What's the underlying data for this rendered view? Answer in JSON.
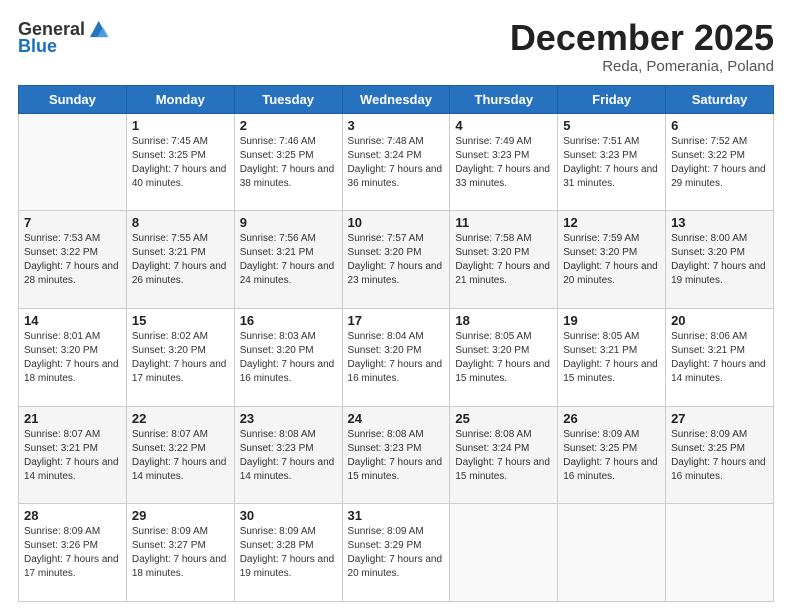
{
  "header": {
    "logo_line1": "General",
    "logo_line2": "Blue",
    "month_title": "December 2025",
    "location": "Reda, Pomerania, Poland"
  },
  "weekdays": [
    "Sunday",
    "Monday",
    "Tuesday",
    "Wednesday",
    "Thursday",
    "Friday",
    "Saturday"
  ],
  "weeks": [
    [
      {
        "day": "",
        "sunrise": "",
        "sunset": "",
        "daylight": ""
      },
      {
        "day": "1",
        "sunrise": "Sunrise: 7:45 AM",
        "sunset": "Sunset: 3:25 PM",
        "daylight": "Daylight: 7 hours and 40 minutes."
      },
      {
        "day": "2",
        "sunrise": "Sunrise: 7:46 AM",
        "sunset": "Sunset: 3:25 PM",
        "daylight": "Daylight: 7 hours and 38 minutes."
      },
      {
        "day": "3",
        "sunrise": "Sunrise: 7:48 AM",
        "sunset": "Sunset: 3:24 PM",
        "daylight": "Daylight: 7 hours and 36 minutes."
      },
      {
        "day": "4",
        "sunrise": "Sunrise: 7:49 AM",
        "sunset": "Sunset: 3:23 PM",
        "daylight": "Daylight: 7 hours and 33 minutes."
      },
      {
        "day": "5",
        "sunrise": "Sunrise: 7:51 AM",
        "sunset": "Sunset: 3:23 PM",
        "daylight": "Daylight: 7 hours and 31 minutes."
      },
      {
        "day": "6",
        "sunrise": "Sunrise: 7:52 AM",
        "sunset": "Sunset: 3:22 PM",
        "daylight": "Daylight: 7 hours and 29 minutes."
      }
    ],
    [
      {
        "day": "7",
        "sunrise": "Sunrise: 7:53 AM",
        "sunset": "Sunset: 3:22 PM",
        "daylight": "Daylight: 7 hours and 28 minutes."
      },
      {
        "day": "8",
        "sunrise": "Sunrise: 7:55 AM",
        "sunset": "Sunset: 3:21 PM",
        "daylight": "Daylight: 7 hours and 26 minutes."
      },
      {
        "day": "9",
        "sunrise": "Sunrise: 7:56 AM",
        "sunset": "Sunset: 3:21 PM",
        "daylight": "Daylight: 7 hours and 24 minutes."
      },
      {
        "day": "10",
        "sunrise": "Sunrise: 7:57 AM",
        "sunset": "Sunset: 3:20 PM",
        "daylight": "Daylight: 7 hours and 23 minutes."
      },
      {
        "day": "11",
        "sunrise": "Sunrise: 7:58 AM",
        "sunset": "Sunset: 3:20 PM",
        "daylight": "Daylight: 7 hours and 21 minutes."
      },
      {
        "day": "12",
        "sunrise": "Sunrise: 7:59 AM",
        "sunset": "Sunset: 3:20 PM",
        "daylight": "Daylight: 7 hours and 20 minutes."
      },
      {
        "day": "13",
        "sunrise": "Sunrise: 8:00 AM",
        "sunset": "Sunset: 3:20 PM",
        "daylight": "Daylight: 7 hours and 19 minutes."
      }
    ],
    [
      {
        "day": "14",
        "sunrise": "Sunrise: 8:01 AM",
        "sunset": "Sunset: 3:20 PM",
        "daylight": "Daylight: 7 hours and 18 minutes."
      },
      {
        "day": "15",
        "sunrise": "Sunrise: 8:02 AM",
        "sunset": "Sunset: 3:20 PM",
        "daylight": "Daylight: 7 hours and 17 minutes."
      },
      {
        "day": "16",
        "sunrise": "Sunrise: 8:03 AM",
        "sunset": "Sunset: 3:20 PM",
        "daylight": "Daylight: 7 hours and 16 minutes."
      },
      {
        "day": "17",
        "sunrise": "Sunrise: 8:04 AM",
        "sunset": "Sunset: 3:20 PM",
        "daylight": "Daylight: 7 hours and 16 minutes."
      },
      {
        "day": "18",
        "sunrise": "Sunrise: 8:05 AM",
        "sunset": "Sunset: 3:20 PM",
        "daylight": "Daylight: 7 hours and 15 minutes."
      },
      {
        "day": "19",
        "sunrise": "Sunrise: 8:05 AM",
        "sunset": "Sunset: 3:21 PM",
        "daylight": "Daylight: 7 hours and 15 minutes."
      },
      {
        "day": "20",
        "sunrise": "Sunrise: 8:06 AM",
        "sunset": "Sunset: 3:21 PM",
        "daylight": "Daylight: 7 hours and 14 minutes."
      }
    ],
    [
      {
        "day": "21",
        "sunrise": "Sunrise: 8:07 AM",
        "sunset": "Sunset: 3:21 PM",
        "daylight": "Daylight: 7 hours and 14 minutes."
      },
      {
        "day": "22",
        "sunrise": "Sunrise: 8:07 AM",
        "sunset": "Sunset: 3:22 PM",
        "daylight": "Daylight: 7 hours and 14 minutes."
      },
      {
        "day": "23",
        "sunrise": "Sunrise: 8:08 AM",
        "sunset": "Sunset: 3:23 PM",
        "daylight": "Daylight: 7 hours and 14 minutes."
      },
      {
        "day": "24",
        "sunrise": "Sunrise: 8:08 AM",
        "sunset": "Sunset: 3:23 PM",
        "daylight": "Daylight: 7 hours and 15 minutes."
      },
      {
        "day": "25",
        "sunrise": "Sunrise: 8:08 AM",
        "sunset": "Sunset: 3:24 PM",
        "daylight": "Daylight: 7 hours and 15 minutes."
      },
      {
        "day": "26",
        "sunrise": "Sunrise: 8:09 AM",
        "sunset": "Sunset: 3:25 PM",
        "daylight": "Daylight: 7 hours and 16 minutes."
      },
      {
        "day": "27",
        "sunrise": "Sunrise: 8:09 AM",
        "sunset": "Sunset: 3:25 PM",
        "daylight": "Daylight: 7 hours and 16 minutes."
      }
    ],
    [
      {
        "day": "28",
        "sunrise": "Sunrise: 8:09 AM",
        "sunset": "Sunset: 3:26 PM",
        "daylight": "Daylight: 7 hours and 17 minutes."
      },
      {
        "day": "29",
        "sunrise": "Sunrise: 8:09 AM",
        "sunset": "Sunset: 3:27 PM",
        "daylight": "Daylight: 7 hours and 18 minutes."
      },
      {
        "day": "30",
        "sunrise": "Sunrise: 8:09 AM",
        "sunset": "Sunset: 3:28 PM",
        "daylight": "Daylight: 7 hours and 19 minutes."
      },
      {
        "day": "31",
        "sunrise": "Sunrise: 8:09 AM",
        "sunset": "Sunset: 3:29 PM",
        "daylight": "Daylight: 7 hours and 20 minutes."
      },
      {
        "day": "",
        "sunrise": "",
        "sunset": "",
        "daylight": ""
      },
      {
        "day": "",
        "sunrise": "",
        "sunset": "",
        "daylight": ""
      },
      {
        "day": "",
        "sunrise": "",
        "sunset": "",
        "daylight": ""
      }
    ]
  ]
}
